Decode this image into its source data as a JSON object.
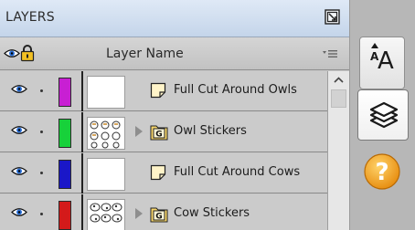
{
  "panel": {
    "title": "LAYERS",
    "column_header": "Layer Name"
  },
  "layers": [
    {
      "name": "Full Cut Around Owls",
      "color": "#c81fd3",
      "type": "path",
      "expandable": false,
      "thumb": "blank",
      "visible": true
    },
    {
      "name": "Owl Stickers",
      "color": "#17d13a",
      "type": "group",
      "expandable": true,
      "thumb": "owls",
      "visible": true
    },
    {
      "name": "Full Cut Around Cows",
      "color": "#1a17c8",
      "type": "path",
      "expandable": false,
      "thumb": "blank",
      "visible": true
    },
    {
      "name": "Cow Stickers",
      "color": "#d41a1a",
      "type": "group",
      "expandable": true,
      "thumb": "cows",
      "visible": true
    }
  ],
  "group_badge": "G",
  "tools": {
    "text_tool_glyph_small": "A",
    "text_tool_glyph_large": "A",
    "help_glyph": "?"
  },
  "colors": {
    "title_gradient_top": "#dfe9f6",
    "help_orange": "#f0a21b"
  }
}
